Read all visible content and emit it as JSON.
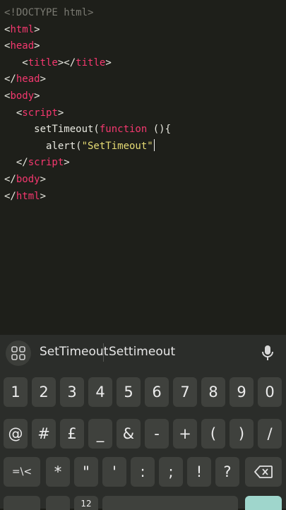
{
  "editor": {
    "lines": [
      [
        {
          "t": "comment",
          "s": "<!DOCTYPE html>"
        }
      ],
      [
        {
          "t": "punct",
          "s": "<"
        },
        {
          "t": "tag",
          "s": "html"
        },
        {
          "t": "punct",
          "s": ">"
        }
      ],
      [
        {
          "t": "punct",
          "s": "<"
        },
        {
          "t": "tag",
          "s": "head"
        },
        {
          "t": "punct",
          "s": ">"
        }
      ],
      [
        {
          "t": "punct",
          "s": "   <"
        },
        {
          "t": "tag",
          "s": "title"
        },
        {
          "t": "punct",
          "s": "></"
        },
        {
          "t": "tag",
          "s": "title"
        },
        {
          "t": "punct",
          "s": ">"
        }
      ],
      [
        {
          "t": "punct",
          "s": "</"
        },
        {
          "t": "tag",
          "s": "head"
        },
        {
          "t": "punct",
          "s": ">"
        }
      ],
      [
        {
          "t": "punct",
          "s": "<"
        },
        {
          "t": "tag",
          "s": "body"
        },
        {
          "t": "punct",
          "s": ">"
        }
      ],
      [
        {
          "t": "punct",
          "s": "  <"
        },
        {
          "t": "tag",
          "s": "script"
        },
        {
          "t": "punct",
          "s": ">"
        }
      ],
      [
        {
          "t": "plain",
          "s": "     setTimeout("
        },
        {
          "t": "keyword",
          "s": "function"
        },
        {
          "t": "plain",
          "s": " (){"
        }
      ],
      [
        {
          "t": "plain",
          "s": "       alert("
        },
        {
          "t": "string",
          "s": "\"SetTimeout\""
        }
      ],
      [
        {
          "t": "punct",
          "s": "  </"
        },
        {
          "t": "tag",
          "s": "script"
        },
        {
          "t": "punct",
          "s": ">"
        }
      ],
      [
        {
          "t": "punct",
          "s": "</"
        },
        {
          "t": "tag",
          "s": "body"
        },
        {
          "t": "punct",
          "s": ">"
        }
      ],
      [
        {
          "t": "punct",
          "s": "</"
        },
        {
          "t": "tag",
          "s": "html"
        },
        {
          "t": "punct",
          "s": ">"
        }
      ]
    ],
    "caret_line": 8
  },
  "keyboard": {
    "suggestions": [
      "SetTimeout",
      "Settimeout"
    ],
    "icons": {
      "apps": "grid-icon",
      "mic": "microphone-icon",
      "backspace": "backspace-icon"
    },
    "row_numbers": [
      "1",
      "2",
      "3",
      "4",
      "5",
      "6",
      "7",
      "8",
      "9",
      "0"
    ],
    "row_symbols1": [
      "@",
      "#",
      "£",
      "_",
      "&",
      "-",
      "+",
      "(",
      ")",
      "/"
    ],
    "row_symbols2": {
      "toggle": "=\\<",
      "keys": [
        "*",
        "\"",
        "'",
        ":",
        ";",
        "!",
        "?"
      ]
    },
    "bottom_row_partial": [
      "",
      "",
      "12",
      "",
      ""
    ]
  }
}
